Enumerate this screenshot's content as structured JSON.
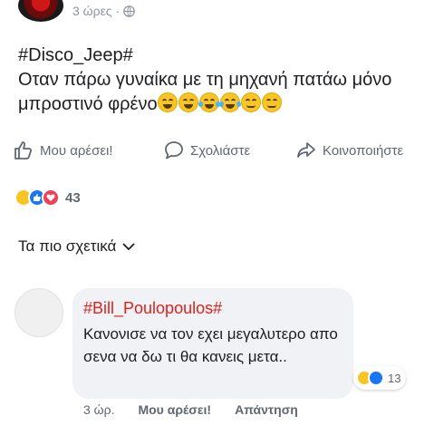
{
  "post": {
    "time": "3 ώρες",
    "separator": "·",
    "hashtag": "#Disco_Jeep#",
    "text": "Οταν πάρω γυναίκα με τη μηχανή πατάω μόνο μπροστινό φρένο",
    "emojis": [
      "grinning-face",
      "grinning-face",
      "face-with-tears-of-joy",
      "face-with-tears-of-joy",
      "smiling-face",
      "smiling-face"
    ]
  },
  "actions": {
    "like": "Μου αρέσει!",
    "comment": "Σχολιάστε",
    "share": "Κοινοποιήστε"
  },
  "reactions": {
    "types": [
      "haha",
      "like",
      "love"
    ],
    "count": "43"
  },
  "sort": {
    "label": "Τα πιο σχετικά"
  },
  "comment": {
    "author": "#Bill_Poulopoulos#",
    "text": "Κανονισε να τον εχει μεγαλυτερο απο σενα να δω τι θα κανεις μετα..",
    "reaction_types": [
      "haha",
      "like"
    ],
    "reaction_count": "13",
    "time": "3 ώρ.",
    "like": "Μου αρέσει!",
    "reply": "Απάντηση"
  },
  "colors": {
    "accent_blue": "#1877f2",
    "comment_author_red": "#e0211b",
    "secondary_text": "#606770"
  }
}
